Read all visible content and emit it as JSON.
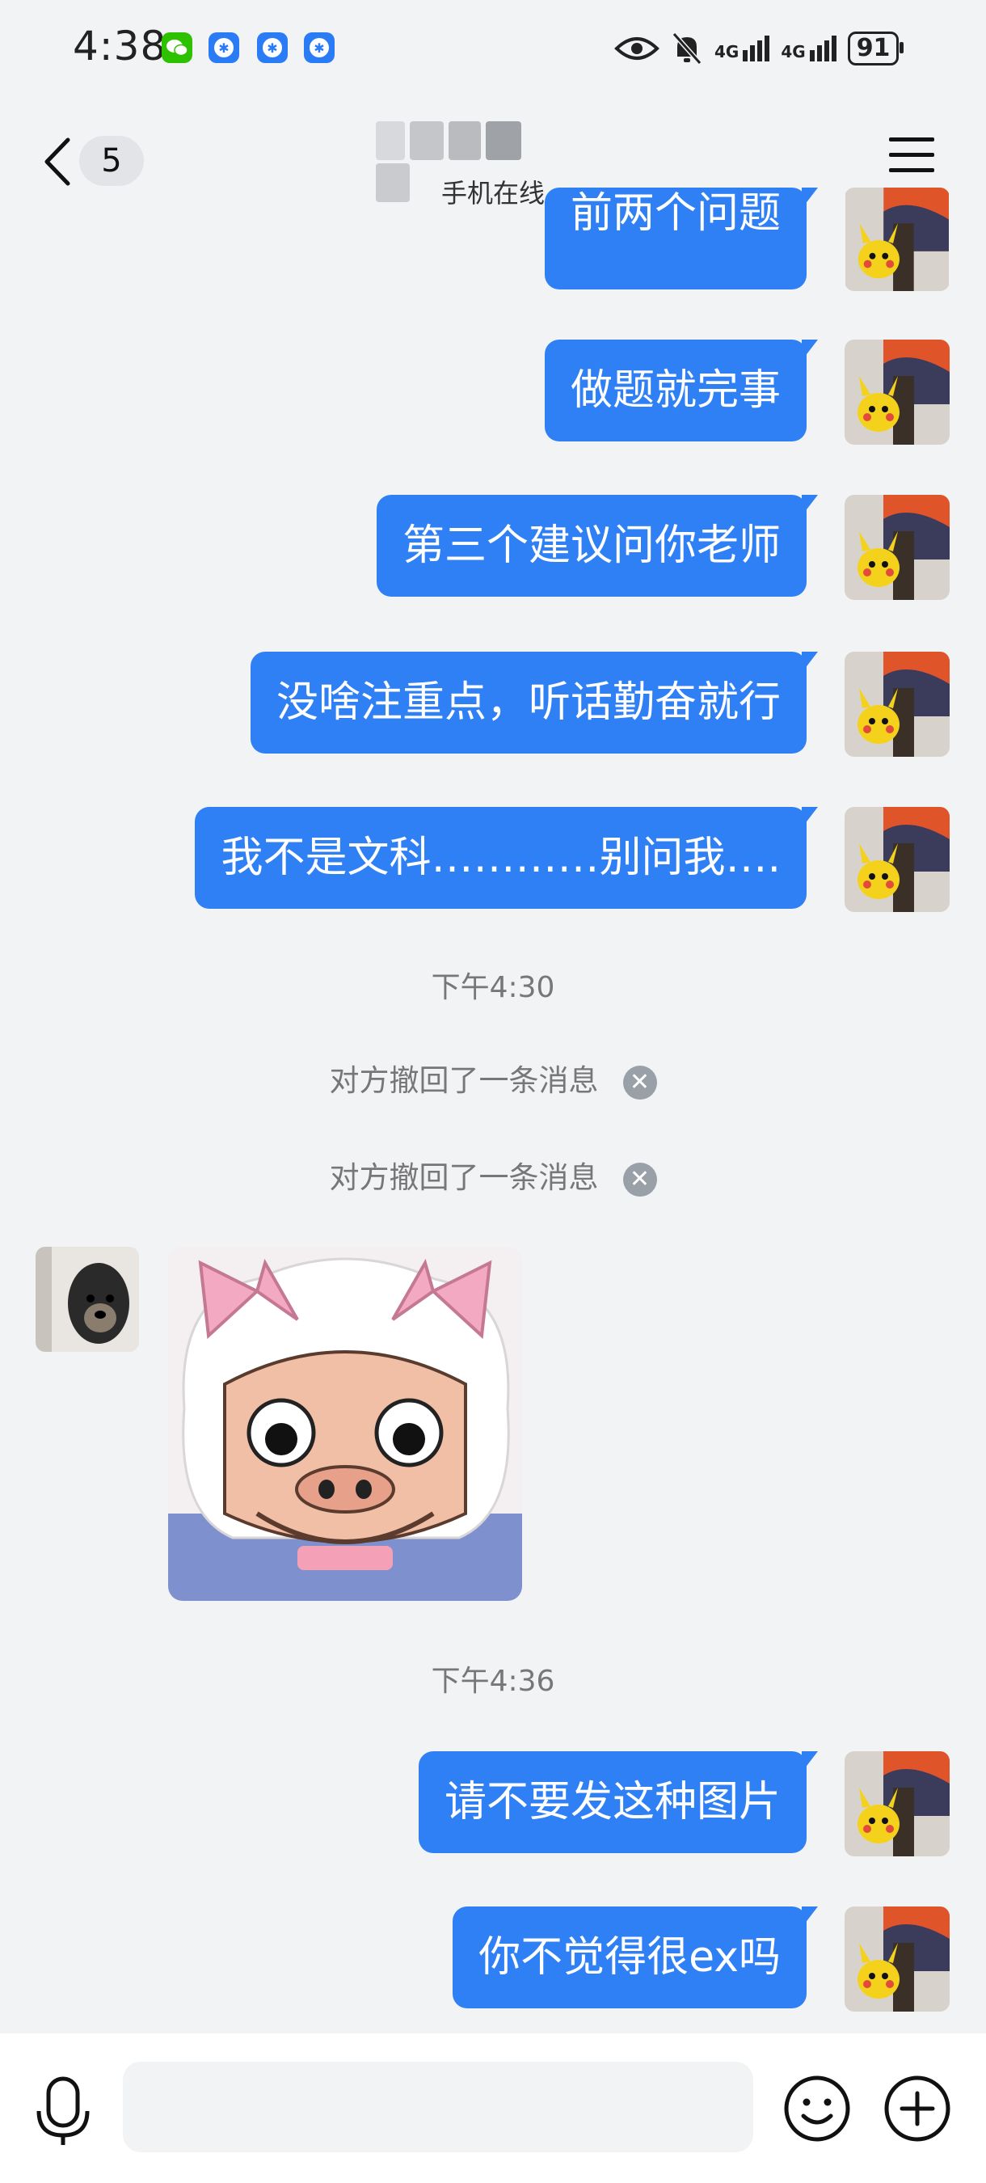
{
  "status_bar": {
    "time": "4:38",
    "network_1": "4G",
    "network_2": "4G",
    "battery": "91"
  },
  "header": {
    "unread_count": "5",
    "contact_status": "手机在线",
    "contact_name_blurred": true
  },
  "colors": {
    "bubble": "#2f80f5",
    "background": "#f2f3f5",
    "wechat_green": "#2dc100",
    "qq_blue": "#2a7cf6"
  },
  "messages": [
    {
      "text": "前两个问题"
    },
    {
      "text": "做题就完事"
    },
    {
      "text": "第三个建议问你老师"
    },
    {
      "text": "没啥注重点，听话勤奋就行"
    },
    {
      "text": "我不是文科…………别问我…."
    }
  ],
  "time_1": "下午4:30",
  "recall_1": "对方撤回了一条消息",
  "recall_2": "对方撤回了一条消息",
  "time_2": "下午4:36",
  "messages_2": [
    {
      "text": "请不要发这种图片"
    },
    {
      "text": "你不觉得很ex吗"
    }
  ],
  "input": {
    "placeholder": ""
  }
}
